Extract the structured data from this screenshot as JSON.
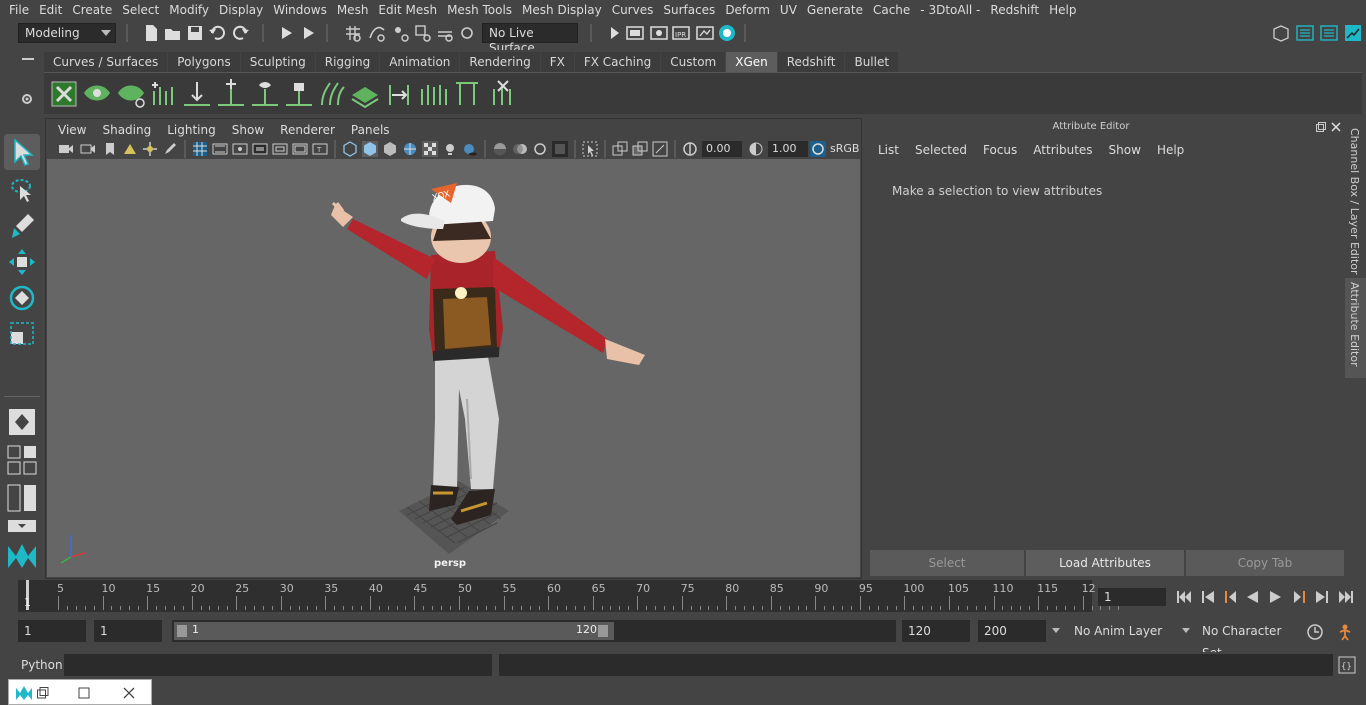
{
  "menubar": {
    "items": [
      "File",
      "Edit",
      "Create",
      "Select",
      "Modify",
      "Display",
      "Windows",
      "Mesh",
      "Edit Mesh",
      "Mesh Tools",
      "Mesh Display",
      "Curves",
      "Surfaces",
      "Deform",
      "UV",
      "Generate",
      "Cache",
      "- 3DtoAll -",
      "Redshift",
      "Help"
    ]
  },
  "statusline": {
    "mode": "Modeling",
    "live_surface": "No Live Surface"
  },
  "shelf": {
    "tabs": [
      "Curves / Surfaces",
      "Polygons",
      "Sculpting",
      "Rigging",
      "Animation",
      "Rendering",
      "FX",
      "FX Caching",
      "Custom",
      "XGen",
      "Redshift",
      "Bullet"
    ],
    "active_tab": "XGen"
  },
  "viewport": {
    "menu": [
      "View",
      "Shading",
      "Lighting",
      "Show",
      "Renderer",
      "Panels"
    ],
    "exposure": "0.00",
    "gamma": "1.00",
    "colorspace": "sRGB",
    "camera_label": "persp"
  },
  "attribute_editor": {
    "title": "Attribute Editor",
    "menu": [
      "List",
      "Selected",
      "Focus",
      "Attributes",
      "Show",
      "Help"
    ],
    "message": "Make a selection to view attributes",
    "buttons": {
      "select": "Select",
      "load": "Load Attributes",
      "copy": "Copy Tab"
    }
  },
  "side_tabs": {
    "channel_box": "Channel Box / Layer Editor",
    "attribute_editor": "Attribute Editor"
  },
  "timeslider": {
    "ticks": [
      "5",
      "10",
      "15",
      "20",
      "25",
      "30",
      "35",
      "40",
      "45",
      "50",
      "55",
      "60",
      "65",
      "70",
      "75",
      "80",
      "85",
      "90",
      "95",
      "100",
      "105",
      "110",
      "115",
      "12"
    ],
    "start_marker": "1",
    "current_frame": "1"
  },
  "range": {
    "start": "1",
    "playback_start": "1",
    "slider_start": "1",
    "slider_end": "120",
    "playback_end": "120",
    "end": "200",
    "anim_layer": "No Anim Layer",
    "character_set": "No Character Set"
  },
  "cmdline": {
    "label": "Python"
  },
  "colors": {
    "bg": "#444444",
    "viewport": "#666666",
    "accent_cyan": "#1fb8c6",
    "active_tab": "#5d5d5d"
  }
}
